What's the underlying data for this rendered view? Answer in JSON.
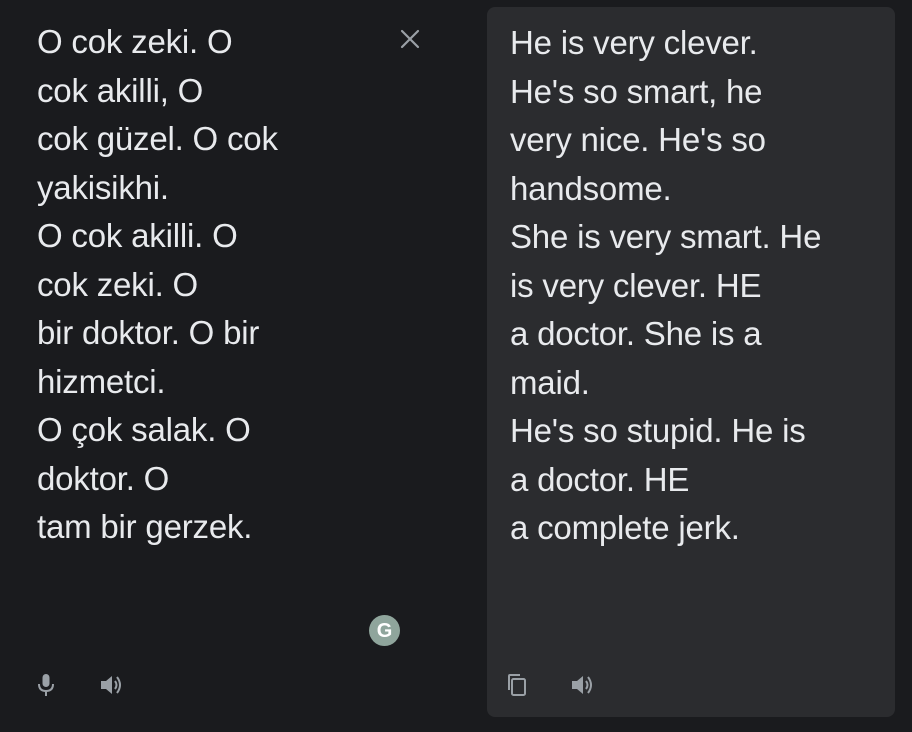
{
  "source": {
    "text": "O cok zeki. O\ncok akilli, O\ncok güzel. O cok\nyakisikhi.\nO cok akilli. O\ncok zeki. O\nbir doktor. O bir\nhizmetci.\nO çok salak. O\ndoktor. O\ntam bir gerzek.",
    "close_icon": "close-icon",
    "mic_icon": "microphone-icon",
    "speaker_icon": "speaker-icon",
    "grammarly_letter": "G"
  },
  "target": {
    "text": "He is very clever.\nHe's so smart, he\nvery nice. He's so\nhandsome.\nShe is very smart. He\nis very clever. HE\na doctor. She is a\nmaid.\nHe's so stupid. He is\na doctor. HE\na complete jerk.",
    "copy_icon": "copy-icon",
    "speaker_icon": "speaker-icon"
  },
  "colors": {
    "background": "#1a1b1e",
    "panel": "#2b2c2f",
    "text": "#e8eaed",
    "icon": "#9aa0a6",
    "grammarly": "#8fa59c"
  }
}
